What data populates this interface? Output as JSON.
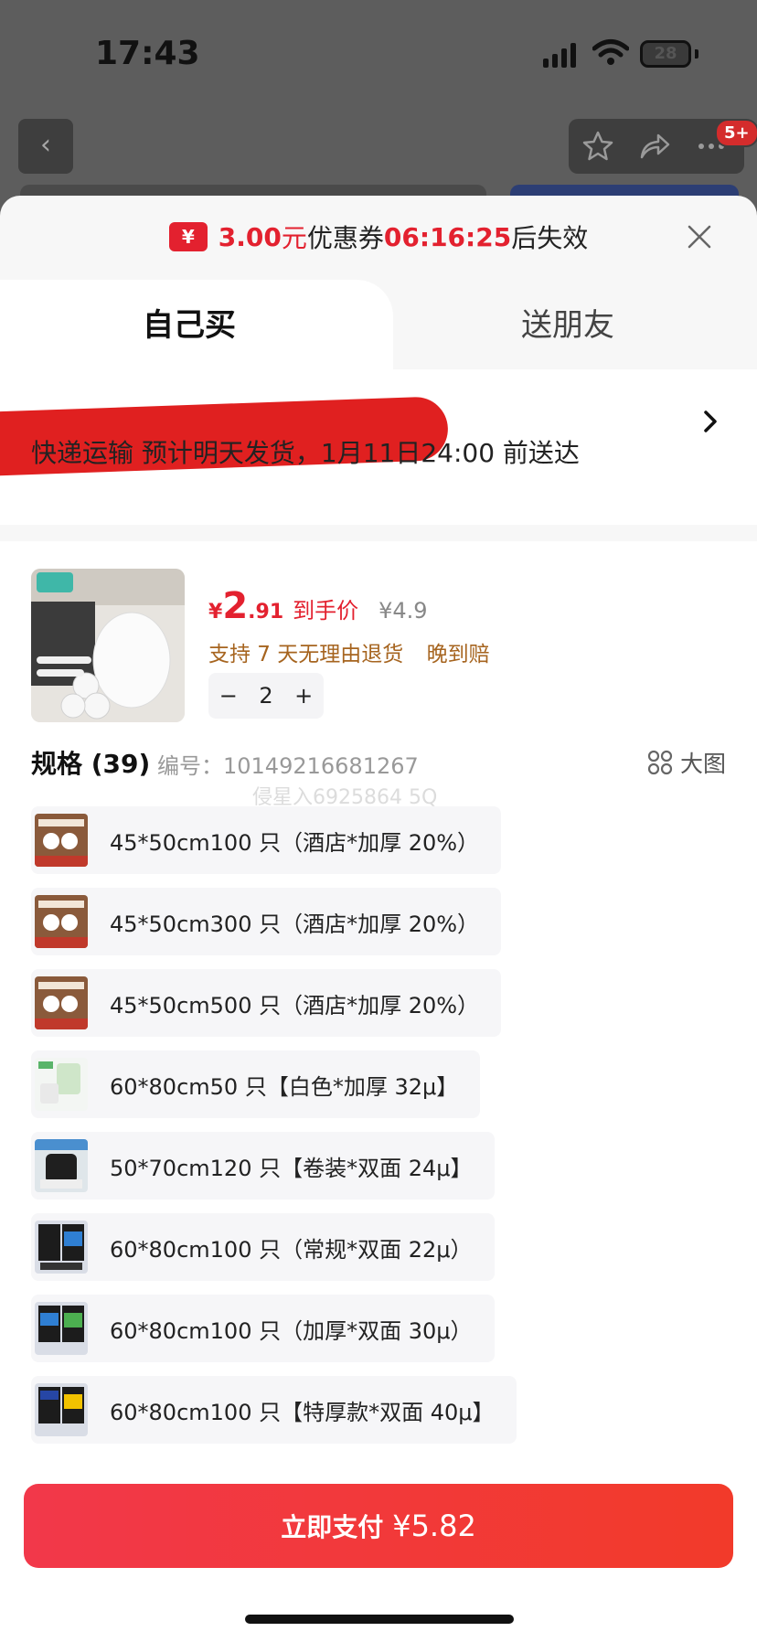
{
  "status_bar": {
    "time": "17:43",
    "battery": "28"
  },
  "background_app": {
    "badge": "5+"
  },
  "coupon": {
    "amount": "3.00",
    "unit": "元",
    "text": "优惠券",
    "countdown": "06:16:25",
    "suffix": "后失效",
    "icon": "¥"
  },
  "tabs": [
    {
      "label": "自己买",
      "active": true
    },
    {
      "label": "送朋友",
      "active": false
    }
  ],
  "shipping": {
    "text": "快递运输 预计明天发货，1月11日24:00 前送达"
  },
  "product": {
    "price_symbol": "¥",
    "price_int": "2",
    "price_dec": ".91",
    "price_label": "到手价",
    "original_price": "¥4.9",
    "services": [
      "支持 7 天无理由退货",
      "晚到赔"
    ],
    "quantity": "2",
    "minus": "−",
    "plus": "+"
  },
  "specs_header": {
    "title": "规格 (39)",
    "code": "编号：10149216681267",
    "big_view": "大图",
    "watermark": "侵星入6925864 5Q"
  },
  "specs": [
    {
      "label": "45*50cm100 只（酒店*加厚 20%）",
      "thumb": "brown"
    },
    {
      "label": "45*50cm300 只（酒店*加厚 20%）",
      "thumb": "brown"
    },
    {
      "label": "45*50cm500 只（酒店*加厚 20%）",
      "thumb": "brown"
    },
    {
      "label": "60*80cm50 只【白色*加厚 32μ】",
      "thumb": "white"
    },
    {
      "label": "50*70cm120 只【卷装*双面 24μ】",
      "thumb": "roll"
    },
    {
      "label": "60*80cm100 只（常规*双面 22μ）",
      "thumb": "black-blue"
    },
    {
      "label": "60*80cm100 只（加厚*双面 30μ）",
      "thumb": "black-green"
    },
    {
      "label": "60*80cm100 只【特厚款*双面 40μ】",
      "thumb": "black-navy"
    }
  ],
  "pay_button": {
    "label": "立即支付",
    "price": "¥5.82"
  },
  "colors": {
    "accent_red": "#e3212f",
    "service_brown": "#a6641f"
  }
}
